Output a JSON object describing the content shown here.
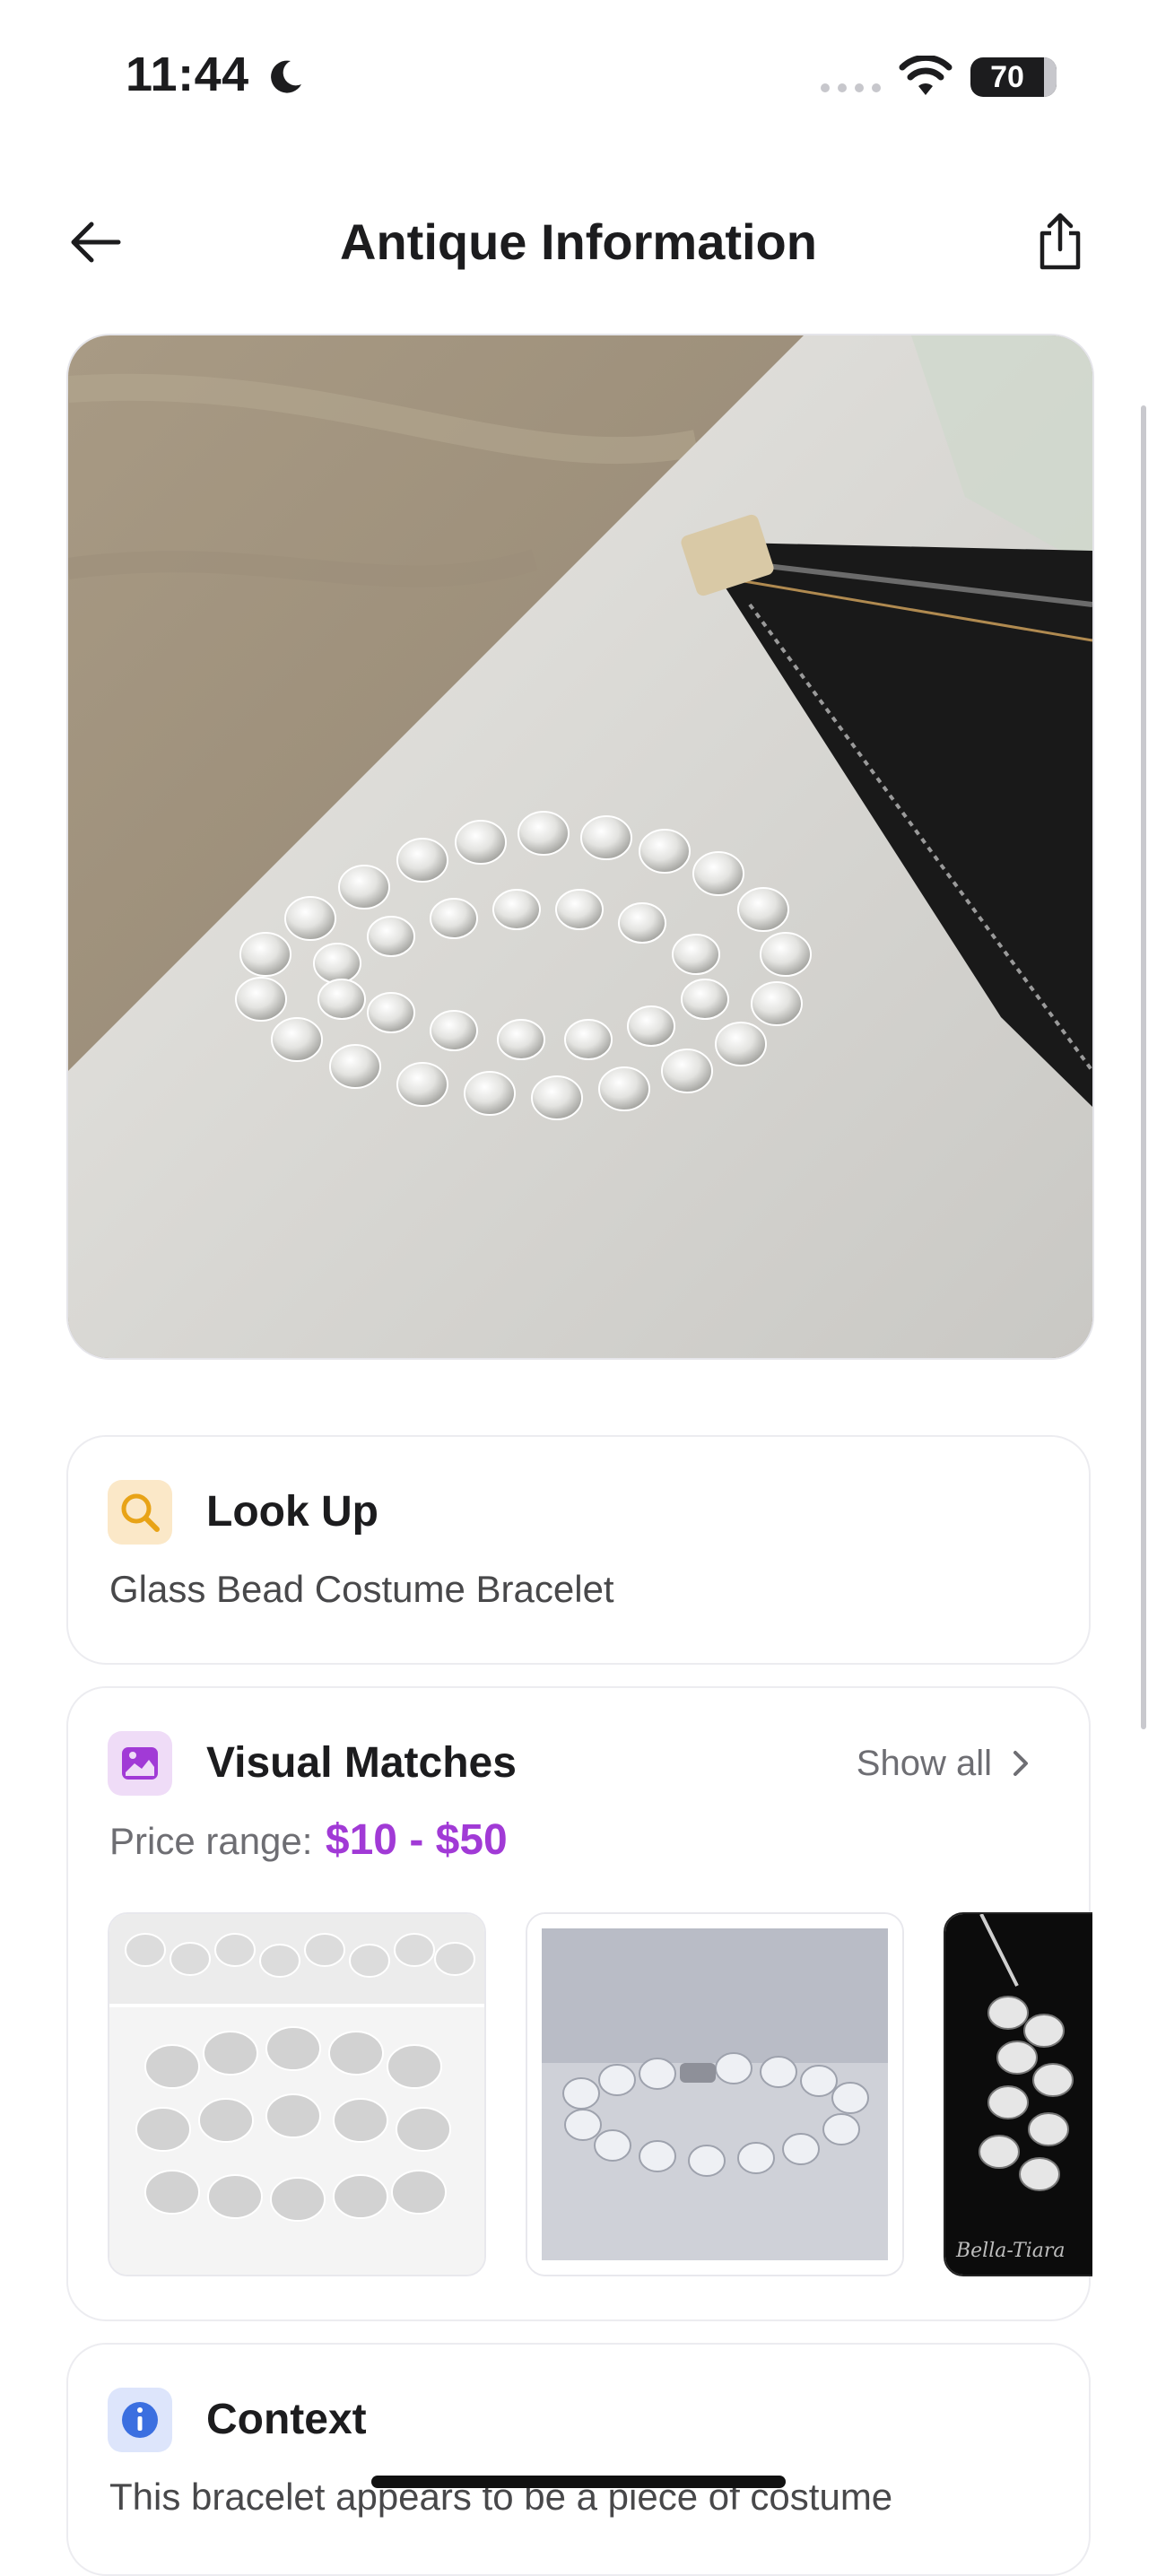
{
  "status_bar": {
    "time": "11:44",
    "battery_level": "70",
    "battery_fraction": 0.7
  },
  "nav": {
    "title": "Antique Information"
  },
  "hero_image": {
    "subject": "clear-glass-bead-bracelet-photo"
  },
  "lookup": {
    "title": "Look Up",
    "value": "Glass Bead Costume Bracelet",
    "icon": "search-icon"
  },
  "visual_matches": {
    "title": "Visual Matches",
    "show_all": "Show all",
    "price_label": "Price range:",
    "price_value": "$10 - $50",
    "watermark": "Bella-Tiara",
    "icon": "image-icon"
  },
  "context": {
    "title": "Context",
    "text": "This bracelet appears to be a piece of costume",
    "icon": "info-icon"
  },
  "colors": {
    "accent_purple": "#a13ad6",
    "lookup_icon_bg": "#fbe8c8",
    "matches_icon_bg": "#efdcf7",
    "context_icon_bg": "#dde5fb"
  }
}
